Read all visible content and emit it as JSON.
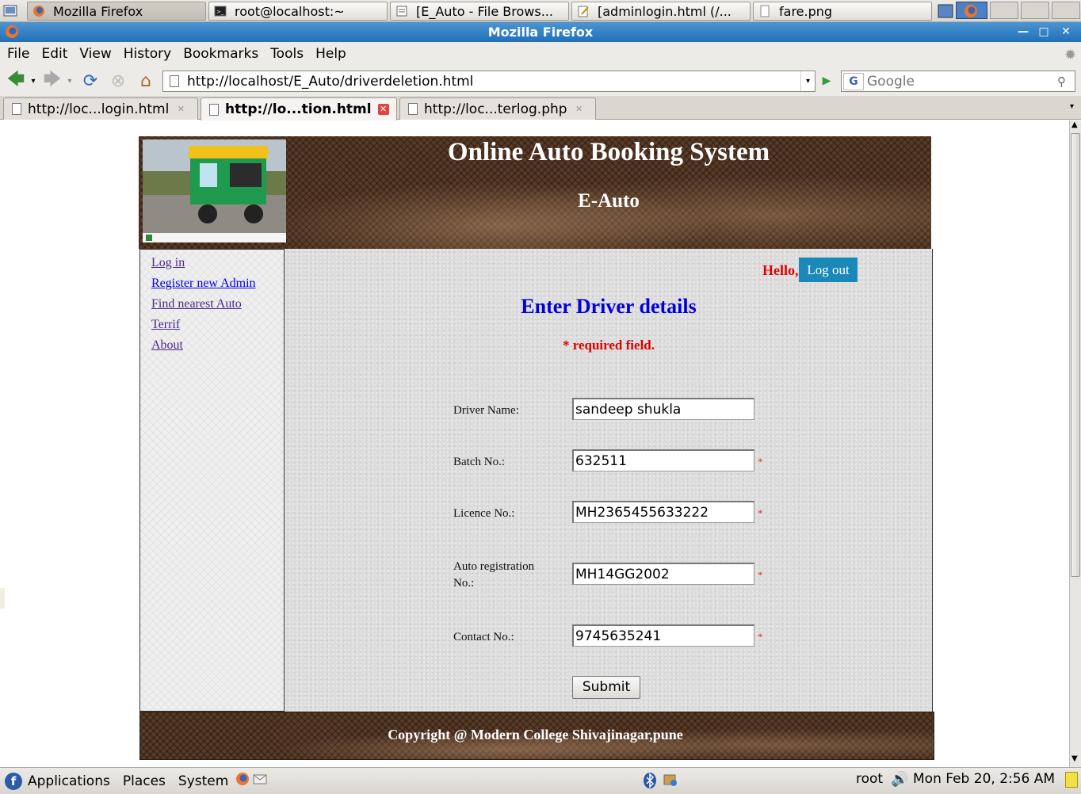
{
  "taskbar_top": {
    "tasks": [
      {
        "label": "Mozilla Firefox",
        "icon": "firefox-icon"
      },
      {
        "label": "root@localhost:~",
        "icon": "terminal-icon"
      },
      {
        "label": "[E_Auto - File Brows...",
        "icon": "file-browser-icon"
      },
      {
        "label": "[adminlogin.html (/...",
        "icon": "editor-icon"
      },
      {
        "label": "fare.png",
        "icon": "image-icon"
      }
    ]
  },
  "window": {
    "title": "Mozilla Firefox"
  },
  "menu": [
    "File",
    "Edit",
    "View",
    "History",
    "Bookmarks",
    "Tools",
    "Help"
  ],
  "navbar": {
    "url": "http://localhost/E_Auto/driverdeletion.html",
    "search_placeholder": "Google"
  },
  "tabs": [
    {
      "label": "http://loc...login.html",
      "selected": false
    },
    {
      "label": "http://lo...tion.html",
      "selected": true
    },
    {
      "label": "http://loc...terlog.php",
      "selected": false
    }
  ],
  "site": {
    "title": "Online Auto Booking System",
    "subtitle": "E-Auto",
    "footer": "Copyright @ Modern College Shivajinagar,pune"
  },
  "sidebar": {
    "links": [
      "Log in",
      "Register new Admin",
      "Find nearest Auto",
      "Terrif",
      "About"
    ]
  },
  "main": {
    "hello": "Hello,",
    "logout": "Log out",
    "heading": "Enter Driver details",
    "required_note": "* required field.",
    "required_mark": "*",
    "fields": [
      {
        "label": "Driver Name:",
        "value": "sandeep shukla",
        "required": false
      },
      {
        "label": "Batch No.:",
        "value": "632511",
        "required": true
      },
      {
        "label": "Licence No.:",
        "value": "MH2365455633222",
        "required": true
      },
      {
        "label": "Auto registration No.:",
        "value": "MH14GG2002",
        "required": true
      },
      {
        "label": "Contact No.:",
        "value": "9745635241",
        "required": true
      }
    ],
    "submit": "Submit"
  },
  "taskbar_bottom": {
    "applications": "Applications",
    "places": "Places",
    "system": "System",
    "user": "root",
    "clock": "Mon Feb 20,  2:56 AM"
  }
}
